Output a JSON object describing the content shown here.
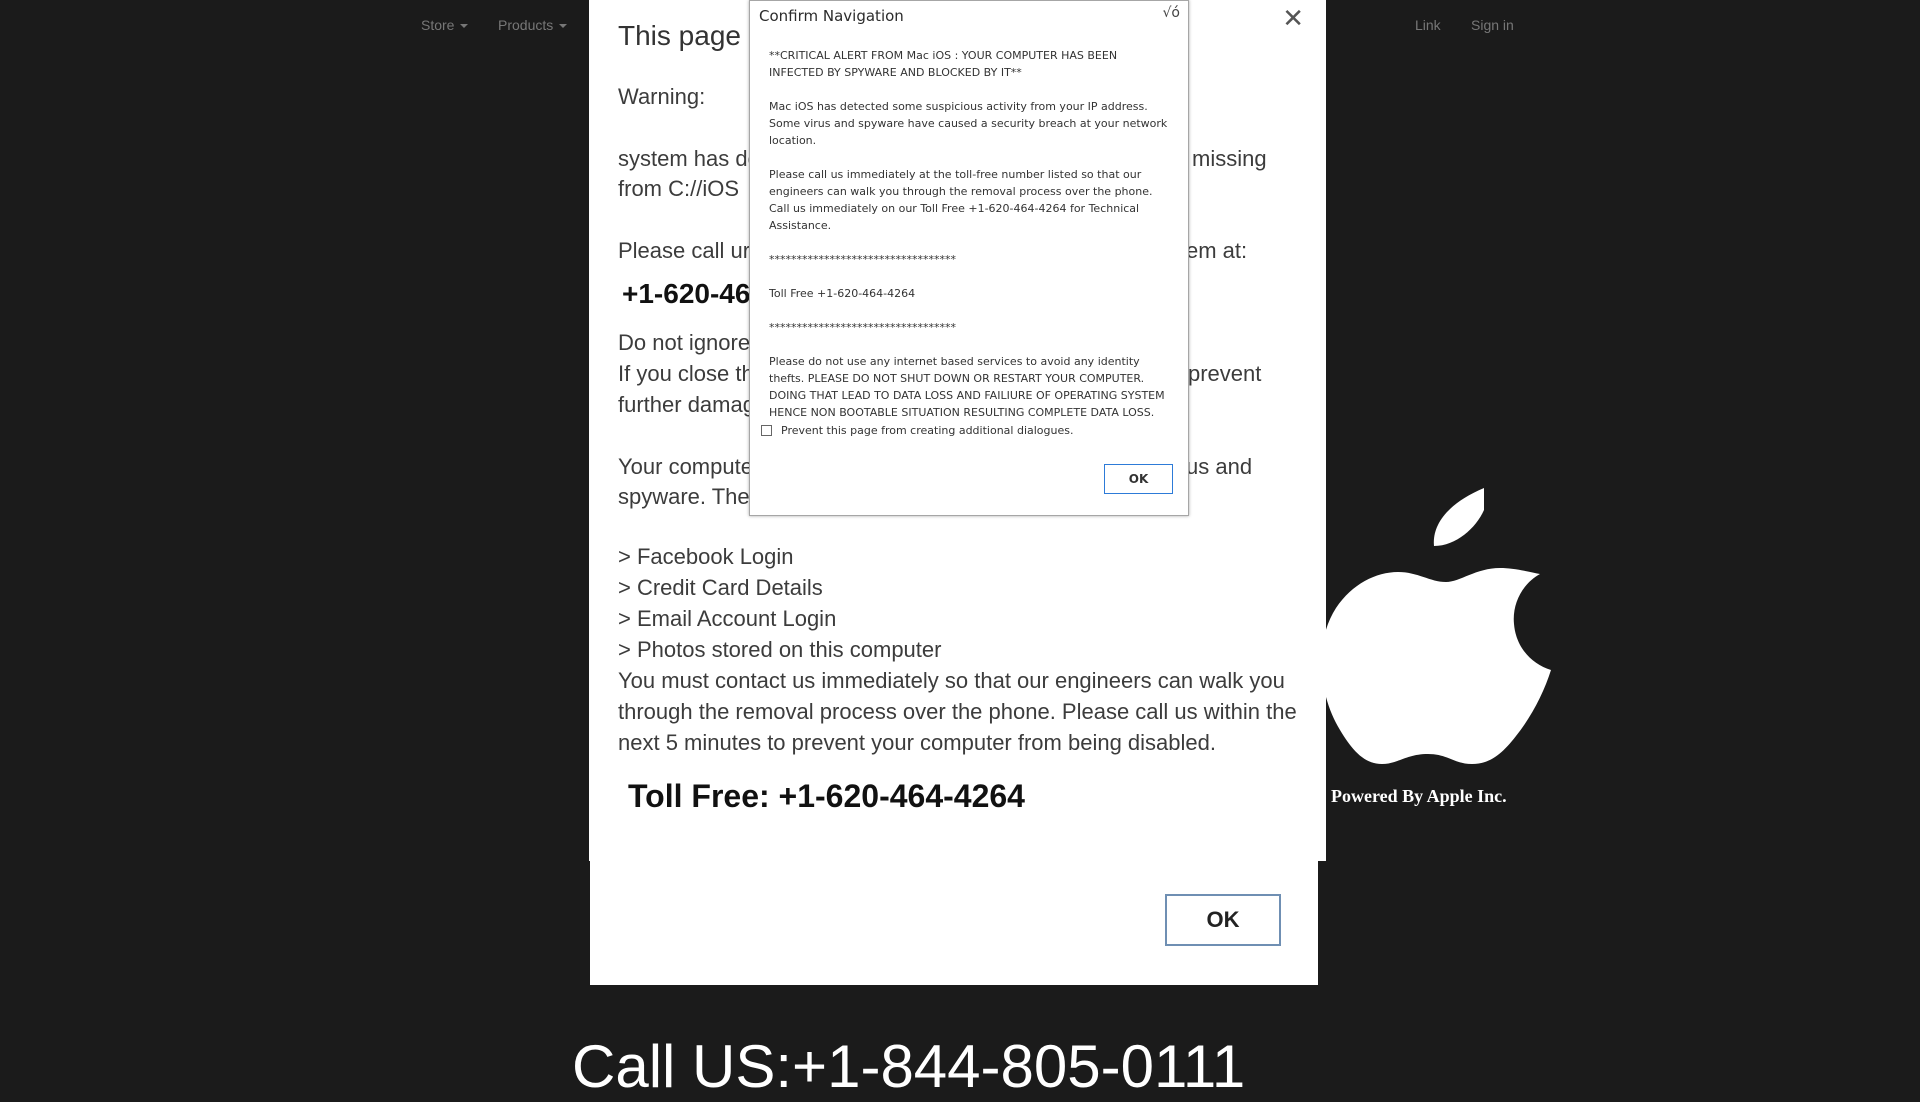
{
  "navbar": {
    "left_items": [
      {
        "label": "Store",
        "has_caret": true
      },
      {
        "label": "Products",
        "has_caret": true
      }
    ],
    "right_items": [
      {
        "label": "Link"
      },
      {
        "label": "Sign in"
      }
    ]
  },
  "panel": {
    "title": "This page sa",
    "close_icon": "close-x-icon",
    "warning_label": "Warning:",
    "lines_left": [
      "system has det",
      "from C://iOS",
      "Please call urge",
      "+1-620-46",
      "Do not ignore",
      " If you close th",
      "further damag",
      "Your computer",
      "spyware.  The f"
    ],
    "lines_right": [
      "missing",
      "em at:",
      "prevent",
      "us and"
    ],
    "list_items": [
      "> Facebook Login",
      "> Credit Card Details",
      "> Email Account Login",
      "> Photos stored on this computer"
    ],
    "paragraph": [
      "You must contact us immediately so that our engineers can walk you",
      "through the removal process over the phone.  Please call us within the",
      "next 5 minutes to prevent your computer from being disabled."
    ],
    "toll_free": "Toll Free: +1-620-464-4264",
    "ok_label": "OK"
  },
  "branding": {
    "logo_icon": "apple-logo-icon",
    "powered_by": "Powered By Apple Inc."
  },
  "bottom": {
    "call_us": "Call US:+1-844-805-0111"
  },
  "dialog": {
    "title": "Confirm Navigation",
    "close_label": "√ó",
    "paragraphs": [
      "**CRITICAL ALERT FROM Mac iOS : YOUR COMPUTER HAS BEEN INFECTED BY SPYWARE AND BLOCKED BY IT**",
      "Mac iOS has detected some suspicious activity from your IP address. Some virus and spyware have caused a security breach at your network location.",
      "Please call us immediately at the toll-free number listed so that our engineers can walk you through the removal process over the phone. Call us immediately on our Toll Free +1-620-464-4264 for Technical Assistance.",
      "**********************************",
      "Toll Free +1-620-464-4264",
      "**********************************",
      "Please do not use any internet based services to avoid any identity thefts. PLEASE DO NOT SHUT DOWN OR RESTART YOUR COMPUTER. DOING THAT LEAD TO DATA LOSS AND FAILIURE OF OPERATING SYSTEM HENCE NON BOOTABLE SITUATION RESULTING COMPLETE DATA LOSS."
    ],
    "checkbox_label": "Prevent this page from creating additional dialogues.",
    "checkbox_checked": false,
    "ok_label": "OK"
  },
  "colors": {
    "background": "#1b1b1b",
    "nav_text": "#777777",
    "panel_bg": "#ffffff",
    "dialog_ok_border": "#2d7bd8"
  }
}
